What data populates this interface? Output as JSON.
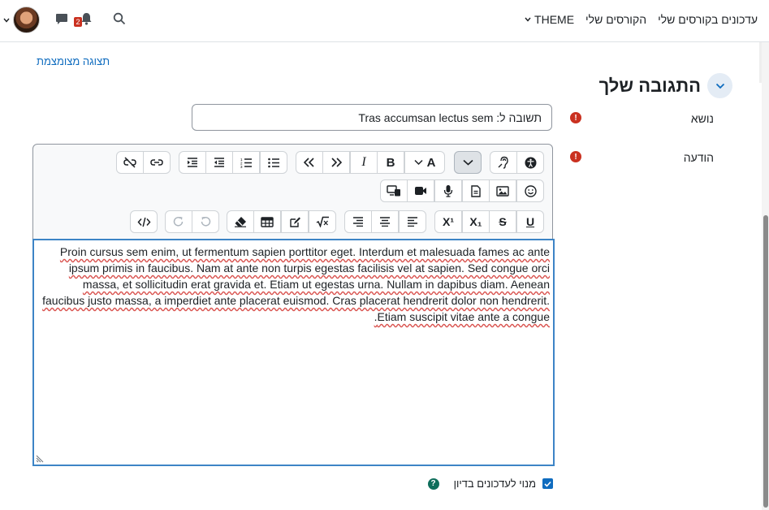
{
  "nav": {
    "links": [
      "עדכונים בקורסים שלי",
      "הקורסים שלי",
      "THEME"
    ],
    "notification_count": "2",
    "icons": [
      "search-icon",
      "bell-icon",
      "chat-icon",
      "avatar",
      "chevron-down-icon"
    ]
  },
  "page": {
    "collapse_link": "תצוגה מצומצמת",
    "section_title": "התגובה שלך"
  },
  "form": {
    "subject_label": "נושא",
    "subject_value": "תשובה ל: Tras accumsan lectus sem",
    "message_label": "הודעה",
    "required_mark": "!",
    "message_text": "Proin cursus sem enim, ut fermentum sapien porttitor eget. Interdum et malesuada fames ac ante ipsum primis in faucibus. Nam at ante non turpis egestas facilisis vel at sapien. Sed congue orci massa, et sollicitudin erat gravida et. Etiam ut egestas urna. Nullam in dapibus diam. Aenean faucibus justo massa, a imperdiet ante placerat euismod. Cras placerat hendrerit dolor non hendrerit. Etiam suscipit vitae ante a congue.",
    "subscribe_label": "מנוי לעדכונים בדיון",
    "subscribe_checked": true,
    "help_mark": "?"
  },
  "toolbar": {
    "bold": "B",
    "italic": "I",
    "font_size": "A",
    "superscript": "X¹",
    "subscript": "X₁",
    "underline": "U",
    "strikethrough": "S"
  },
  "colors": {
    "accent": "#0f6cbf",
    "danger": "#ca3120",
    "editor_focus": "#3d84c6"
  }
}
